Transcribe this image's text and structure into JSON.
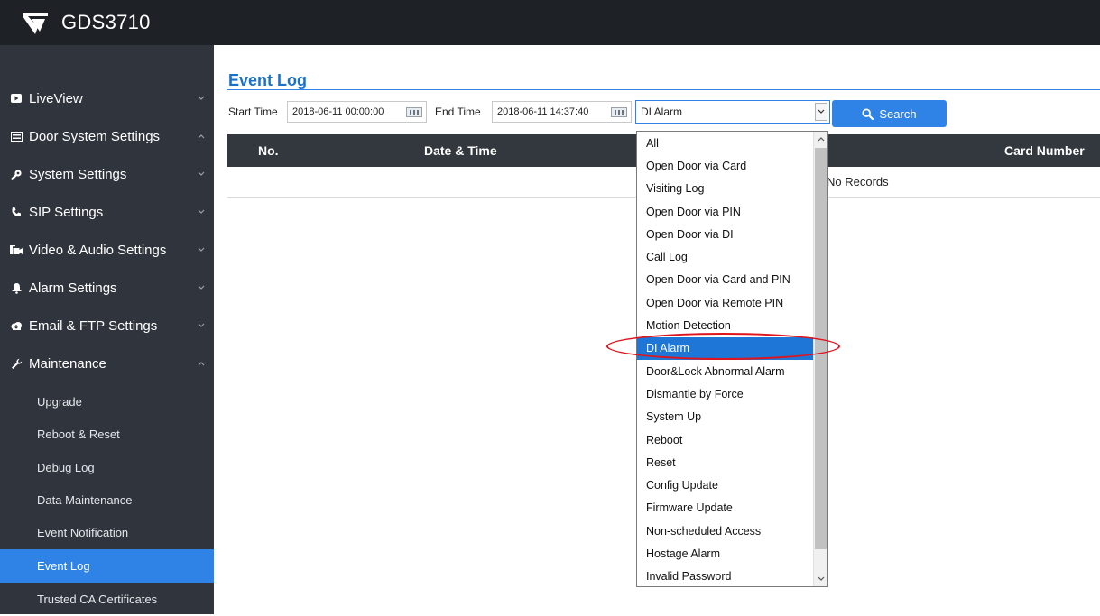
{
  "app": {
    "title": "GDS3710"
  },
  "sidebar": {
    "items": [
      {
        "label": "LiveView",
        "icon": "video-icon",
        "expanded": false
      },
      {
        "label": "Door System Settings",
        "icon": "door-panel-icon",
        "expanded": true
      },
      {
        "label": "System Settings",
        "icon": "wrench-gear-icon",
        "expanded": false
      },
      {
        "label": "SIP Settings",
        "icon": "phone-icon",
        "expanded": false
      },
      {
        "label": "Video & Audio Settings",
        "icon": "camera-mic-icon",
        "expanded": false
      },
      {
        "label": "Alarm Settings",
        "icon": "bell-icon",
        "expanded": false
      },
      {
        "label": "Email & FTP Settings",
        "icon": "cloud-icon",
        "expanded": false
      },
      {
        "label": "Maintenance",
        "icon": "wrench-icon",
        "expanded": true
      }
    ],
    "subitems": [
      {
        "label": "Upgrade",
        "active": false
      },
      {
        "label": "Reboot & Reset",
        "active": false
      },
      {
        "label": "Debug Log",
        "active": false
      },
      {
        "label": "Data Maintenance",
        "active": false
      },
      {
        "label": "Event Notification",
        "active": false
      },
      {
        "label": "Event Log",
        "active": true
      },
      {
        "label": "Trusted CA Certificates",
        "active": false
      }
    ]
  },
  "page": {
    "title": "Event Log"
  },
  "filters": {
    "start_label": "Start Time",
    "start_value": "2018-06-11 00:00:00",
    "end_label": "End Time",
    "end_value": "2018-06-11 14:37:40",
    "type_selected": "DI Alarm",
    "search_label": "Search"
  },
  "table": {
    "columns": [
      "No.",
      "Date & Time",
      "Card Number"
    ],
    "empty_text": "No Records"
  },
  "dropdown": {
    "options": [
      "All",
      "Open Door via Card",
      "Visiting Log",
      "Open Door via PIN",
      "Open Door via DI",
      "Call Log",
      "Open Door via Card and PIN",
      "Open Door via Remote PIN",
      "Motion Detection",
      "DI Alarm",
      "Door&Lock Abnormal Alarm",
      "Dismantle by Force",
      "System Up",
      "Reboot",
      "Reset",
      "Config Update",
      "Firmware Update",
      "Non-scheduled Access",
      "Hostage Alarm",
      "Invalid Password"
    ],
    "selected": "DI Alarm"
  },
  "colors": {
    "topbar": "#1e2227",
    "sidebar": "#30353d",
    "accent": "#2f83e6",
    "highlight": "#1e76d6",
    "annotation": "#e0141c"
  }
}
